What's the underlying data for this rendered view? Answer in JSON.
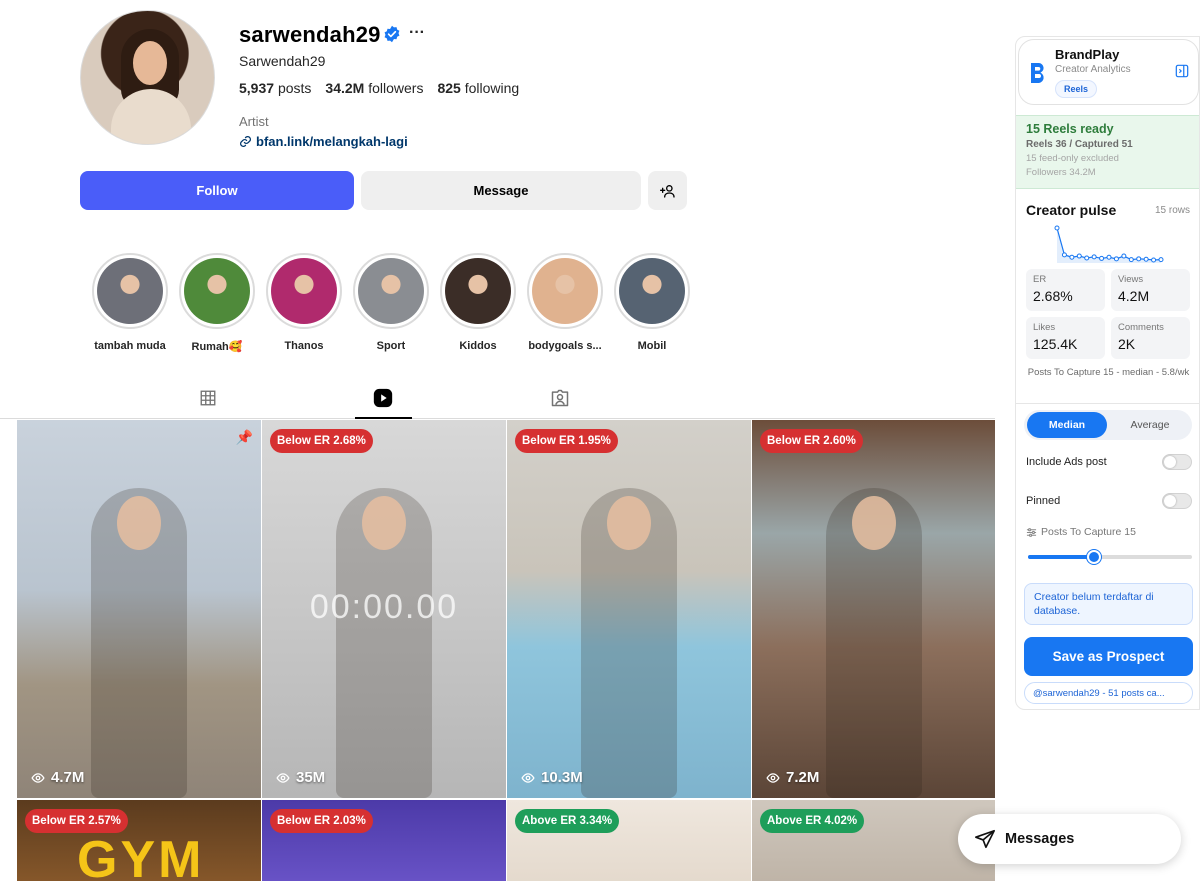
{
  "profile": {
    "username": "sarwendah29",
    "full_name": "Sarwendah29",
    "posts_count": "5,937",
    "posts_label": "posts",
    "followers_count": "34.2M",
    "followers_label": "followers",
    "following_count": "825",
    "following_label": "following",
    "category": "Artist",
    "link": "bfan.link/melangkah-lagi",
    "more_icon": "more-horizontal-icon"
  },
  "actions": {
    "follow_label": "Follow",
    "message_label": "Message",
    "add_user_icon": "add-user-icon"
  },
  "highlights": [
    {
      "label": "tambah muda",
      "color": "#6d6f78"
    },
    {
      "label": "Rumah🥰",
      "color": "#4f8a3a"
    },
    {
      "label": "Thanos",
      "color": "#b02a6d"
    },
    {
      "label": "Sport",
      "color": "#8a8d92"
    },
    {
      "label": "Kiddos",
      "color": "#3b2d27"
    },
    {
      "label": "bodygoals s...",
      "color": "#e0b28f"
    },
    {
      "label": "Mobil",
      "color": "#566372"
    }
  ],
  "tabs": [
    "grid-icon",
    "reels-icon",
    "tagged-icon"
  ],
  "grid": [
    {
      "badge": "",
      "views": "",
      "bg": "linear-gradient(180deg,#3a2f2a,#6b5a4c)"
    },
    {
      "badge": "",
      "views": "4.7M",
      "pinned": true,
      "bg": "linear-gradient(180deg,#c9d2dc 0%,#b9c4cf 45%,#a19583 70%,#8f8478 100%)"
    },
    {
      "badge": "Below ER 2.68%",
      "badge_type": "below",
      "views": "35M",
      "timer": "00:00.00",
      "bg": "linear-gradient(180deg,#d8d8d8 0%,#c4c4c4 60%,#b6b6b6 100%)"
    },
    {
      "badge": "Below ER 1.95%",
      "badge_type": "below",
      "views": "10.3M",
      "bg": "linear-gradient(180deg,#d3d0ca 0%,#c9c4ba 40%,#8fc5dc 60%,#7eb3cd 100%)"
    },
    {
      "badge": "Below ER 2.60%",
      "badge_type": "below",
      "views": "7.2M",
      "bg": "linear-gradient(180deg,#6c4d3a 0%,#9aa6a8 30%,#8c6f5c 60%,#5b4537 100%)"
    },
    {
      "badge": "Below ER 2.57%",
      "badge_type": "below",
      "views": "",
      "overlay": "GYM",
      "bg": "linear-gradient(180deg,#5b3b1e,#8a5a2b)"
    },
    {
      "badge": "Below ER 2.03%",
      "badge_type": "below",
      "views": "",
      "bg": "linear-gradient(180deg,#4c3aa8,#6b55c9)"
    },
    {
      "badge": "Above ER 3.34%",
      "badge_type": "above",
      "views": "",
      "bg": "linear-gradient(180deg,#efe7de,#e3d8cb)"
    },
    {
      "badge": "Above ER 4.02%",
      "badge_type": "above",
      "views": "",
      "bg": "linear-gradient(180deg,#cfc7bd,#bdb2a5)"
    }
  ],
  "brandplay": {
    "title": "BrandPlay",
    "subtitle": "Creator Analytics",
    "chip": "Reels",
    "ready_title": "15 Reels ready",
    "ready_detail": "Reels 36 / Captured 51",
    "excluded": "15 feed-only excluded",
    "followers": "Followers 34.2M",
    "pulse_title": "Creator pulse",
    "pulse_rows": "15 rows",
    "sparkline": [
      10.0,
      3.2,
      2.6,
      2.9,
      2.4,
      2.7,
      2.3,
      2.6,
      2.2,
      2.9,
      2.0,
      2.2,
      2.1,
      1.9,
      2.0
    ],
    "metrics": [
      {
        "label": "ER",
        "value": "2.68%"
      },
      {
        "label": "Views",
        "value": "4.2M"
      },
      {
        "label": "Likes",
        "value": "125.4K"
      },
      {
        "label": "Comments",
        "value": "2K"
      }
    ],
    "capture_note": "Posts To Capture 15 - median - 5.8/wk",
    "mode_median": "Median",
    "mode_average": "Average",
    "include_ads_label": "Include Ads post",
    "pinned_label": "Pinned",
    "capture_label": "Posts To Capture 15",
    "capture_slider_value": 0.4,
    "info_text": "Creator belum terdaftar di database.",
    "save_label": "Save as Prospect",
    "footer": "@sarwendah29 - 51 posts ca..."
  },
  "messages_label": "Messages",
  "colors": {
    "accent": "#4a5df9",
    "brand_blue": "#1877f2",
    "below": "#d63031",
    "above": "#1e9e5a"
  }
}
